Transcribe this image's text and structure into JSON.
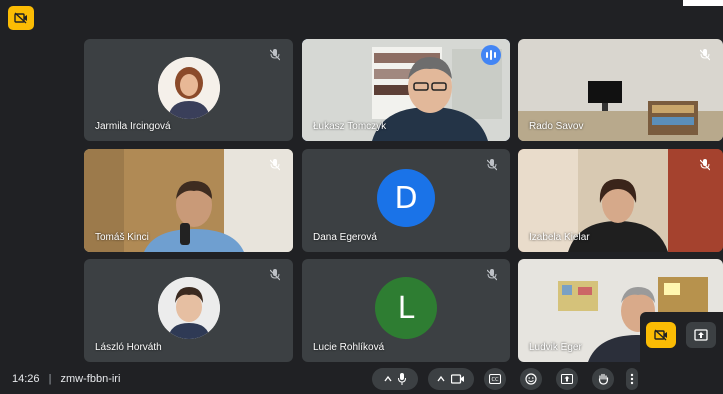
{
  "meeting": {
    "time": "14:26",
    "separator": "|",
    "code": "zmw-fbbn-iri"
  },
  "participants": [
    {
      "name": "Jarmila Ircingová",
      "muted": true,
      "type": "photo-avatar"
    },
    {
      "name": "Łukasz Tomczyk",
      "muted": false,
      "speaking": true,
      "type": "video"
    },
    {
      "name": "Rado Savov",
      "muted": true,
      "type": "video"
    },
    {
      "name": "Tomáš Kinci",
      "muted": true,
      "type": "video"
    },
    {
      "name": "Dana Egerová",
      "muted": true,
      "type": "letter",
      "letter": "D"
    },
    {
      "name": "Izabela Kielar",
      "muted": true,
      "type": "video"
    },
    {
      "name": "László Horváth",
      "muted": true,
      "type": "photo-avatar"
    },
    {
      "name": "Lucie Rohlíková",
      "muted": true,
      "type": "letter",
      "letter": "L"
    },
    {
      "name": "Ludvik Eger",
      "muted": false,
      "type": "video"
    }
  ],
  "colors": {
    "background": "#202124",
    "tile": "#3c4043",
    "accent_yellow": "#fbbc04",
    "avatar_dana": "#1a73e8",
    "avatar_lucie": "#2e7d32",
    "speaking": "#8ab4f8"
  },
  "icons": {
    "mute": "mic-off-icon",
    "camera_off": "camera-off-icon",
    "mic": "mic-icon",
    "camera": "camera-icon",
    "captions": "captions-icon",
    "emoji": "emoji-icon",
    "present": "present-icon",
    "hand": "raise-hand-icon",
    "more": "more-icon"
  }
}
